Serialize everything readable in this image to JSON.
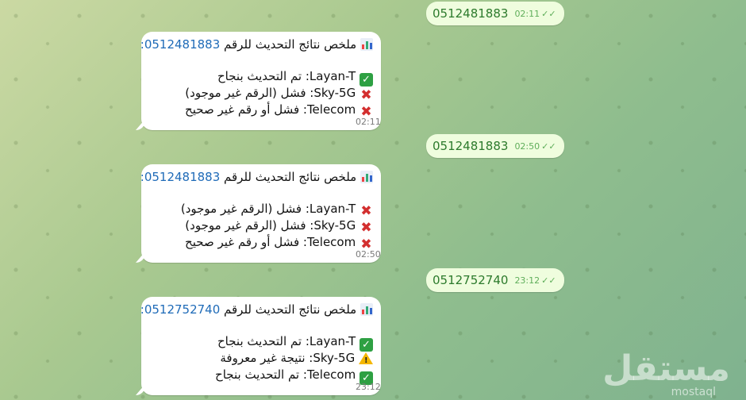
{
  "outgoing": [
    {
      "number": "0512481883",
      "time": "02:11"
    },
    {
      "number": "0512481883",
      "time": "02:50"
    },
    {
      "number": "0512752740",
      "time": "23:12"
    }
  ],
  "incoming": [
    {
      "title_prefix": "ملخص نتائج التحديث للرقم ",
      "number": "0512481883:",
      "lines": [
        {
          "icon": "check",
          "text": "Layan-T: تم التحديث بنجاح"
        },
        {
          "icon": "cross",
          "text": "Sky-5G: فشل (الرقم غير موجود)"
        },
        {
          "icon": "cross",
          "text": "Telecom: فشل أو رقم غير صحيح"
        }
      ],
      "time": "02:11"
    },
    {
      "title_prefix": "ملخص نتائج التحديث للرقم ",
      "number": "0512481883:",
      "lines": [
        {
          "icon": "cross",
          "text": "Layan-T: فشل (الرقم غير موجود)"
        },
        {
          "icon": "cross",
          "text": "Sky-5G: فشل (الرقم غير موجود)"
        },
        {
          "icon": "cross",
          "text": "Telecom: فشل أو رقم غير صحيح"
        }
      ],
      "time": "02:50"
    },
    {
      "title_prefix": "ملخص نتائج التحديث للرقم ",
      "number": "0512752740:",
      "lines": [
        {
          "icon": "check",
          "text": "Layan-T: تم التحديث بنجاح"
        },
        {
          "icon": "warning",
          "text": "Sky-5G: نتيجة غير معروفة"
        },
        {
          "icon": "check",
          "text": "Telecom: تم التحديث بنجاح"
        }
      ],
      "time": "23:12"
    }
  ],
  "watermark": {
    "text": "مستقل",
    "sub": "mostaql"
  },
  "colors": {
    "bubble_out": "#effdde",
    "bubble_in": "#ffffff",
    "link": "#1f6bb8",
    "check": "#2ea043",
    "cross": "#d32f2f",
    "warning": "#f5b700"
  }
}
